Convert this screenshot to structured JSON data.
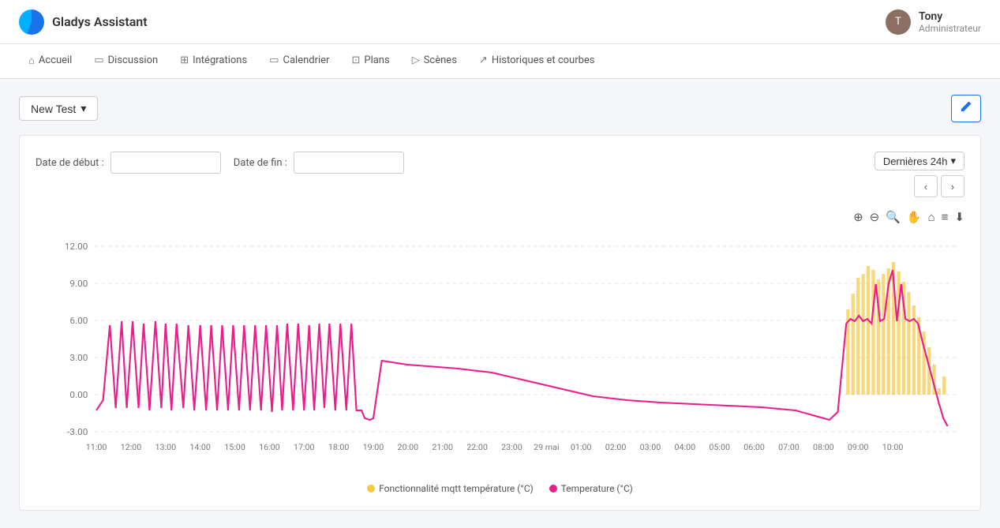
{
  "header": {
    "app_title": "Gladys Assistant",
    "user_name": "Tony",
    "user_role": "Administrateur",
    "avatar_text": "T"
  },
  "nav": {
    "items": [
      {
        "id": "accueil",
        "icon": "⌂",
        "label": "Accueil"
      },
      {
        "id": "discussion",
        "icon": "☰",
        "label": "Discussion"
      },
      {
        "id": "integrations",
        "icon": "⊞",
        "label": "Intégrations"
      },
      {
        "id": "calendrier",
        "icon": "📅",
        "label": "Calendrier"
      },
      {
        "id": "plans",
        "icon": "⊡",
        "label": "Plans"
      },
      {
        "id": "scenes",
        "icon": "▷",
        "label": "Scènes"
      },
      {
        "id": "historiques",
        "icon": "↗",
        "label": "Historiques et courbes"
      }
    ]
  },
  "toolbar": {
    "dropdown_label": "New Test",
    "dropdown_arrow": "▾",
    "edit_icon": "✎"
  },
  "chart": {
    "time_range_label": "Dernières 24h",
    "date_start_label": "Date de début :",
    "date_end_label": "Date de fin :",
    "date_start_value": "",
    "date_end_value": "",
    "y_labels": [
      "12.00",
      "9.00",
      "6.00",
      "3.00",
      "0.00",
      "-3.00"
    ],
    "x_labels": [
      "11:00",
      "12:00",
      "13:00",
      "14:00",
      "15:00",
      "16:00",
      "17:00",
      "18:00",
      "19:00",
      "20:00",
      "21:00",
      "22:00",
      "23:00",
      "29 mai",
      "01:00",
      "02:00",
      "03:00",
      "04:00",
      "05:00",
      "06:00",
      "07:00",
      "08:00",
      "09:00",
      "10:00"
    ],
    "icons": [
      "⊕",
      "⊖",
      "🔍",
      "✋",
      "⌂",
      "≡",
      "⬇"
    ],
    "legend": [
      {
        "id": "mqtt",
        "color": "#f5c842",
        "label": "Fonctionnalité mqtt température (°C)"
      },
      {
        "id": "temp",
        "color": "#e91e8c",
        "label": "Temperature (°C)"
      }
    ]
  }
}
